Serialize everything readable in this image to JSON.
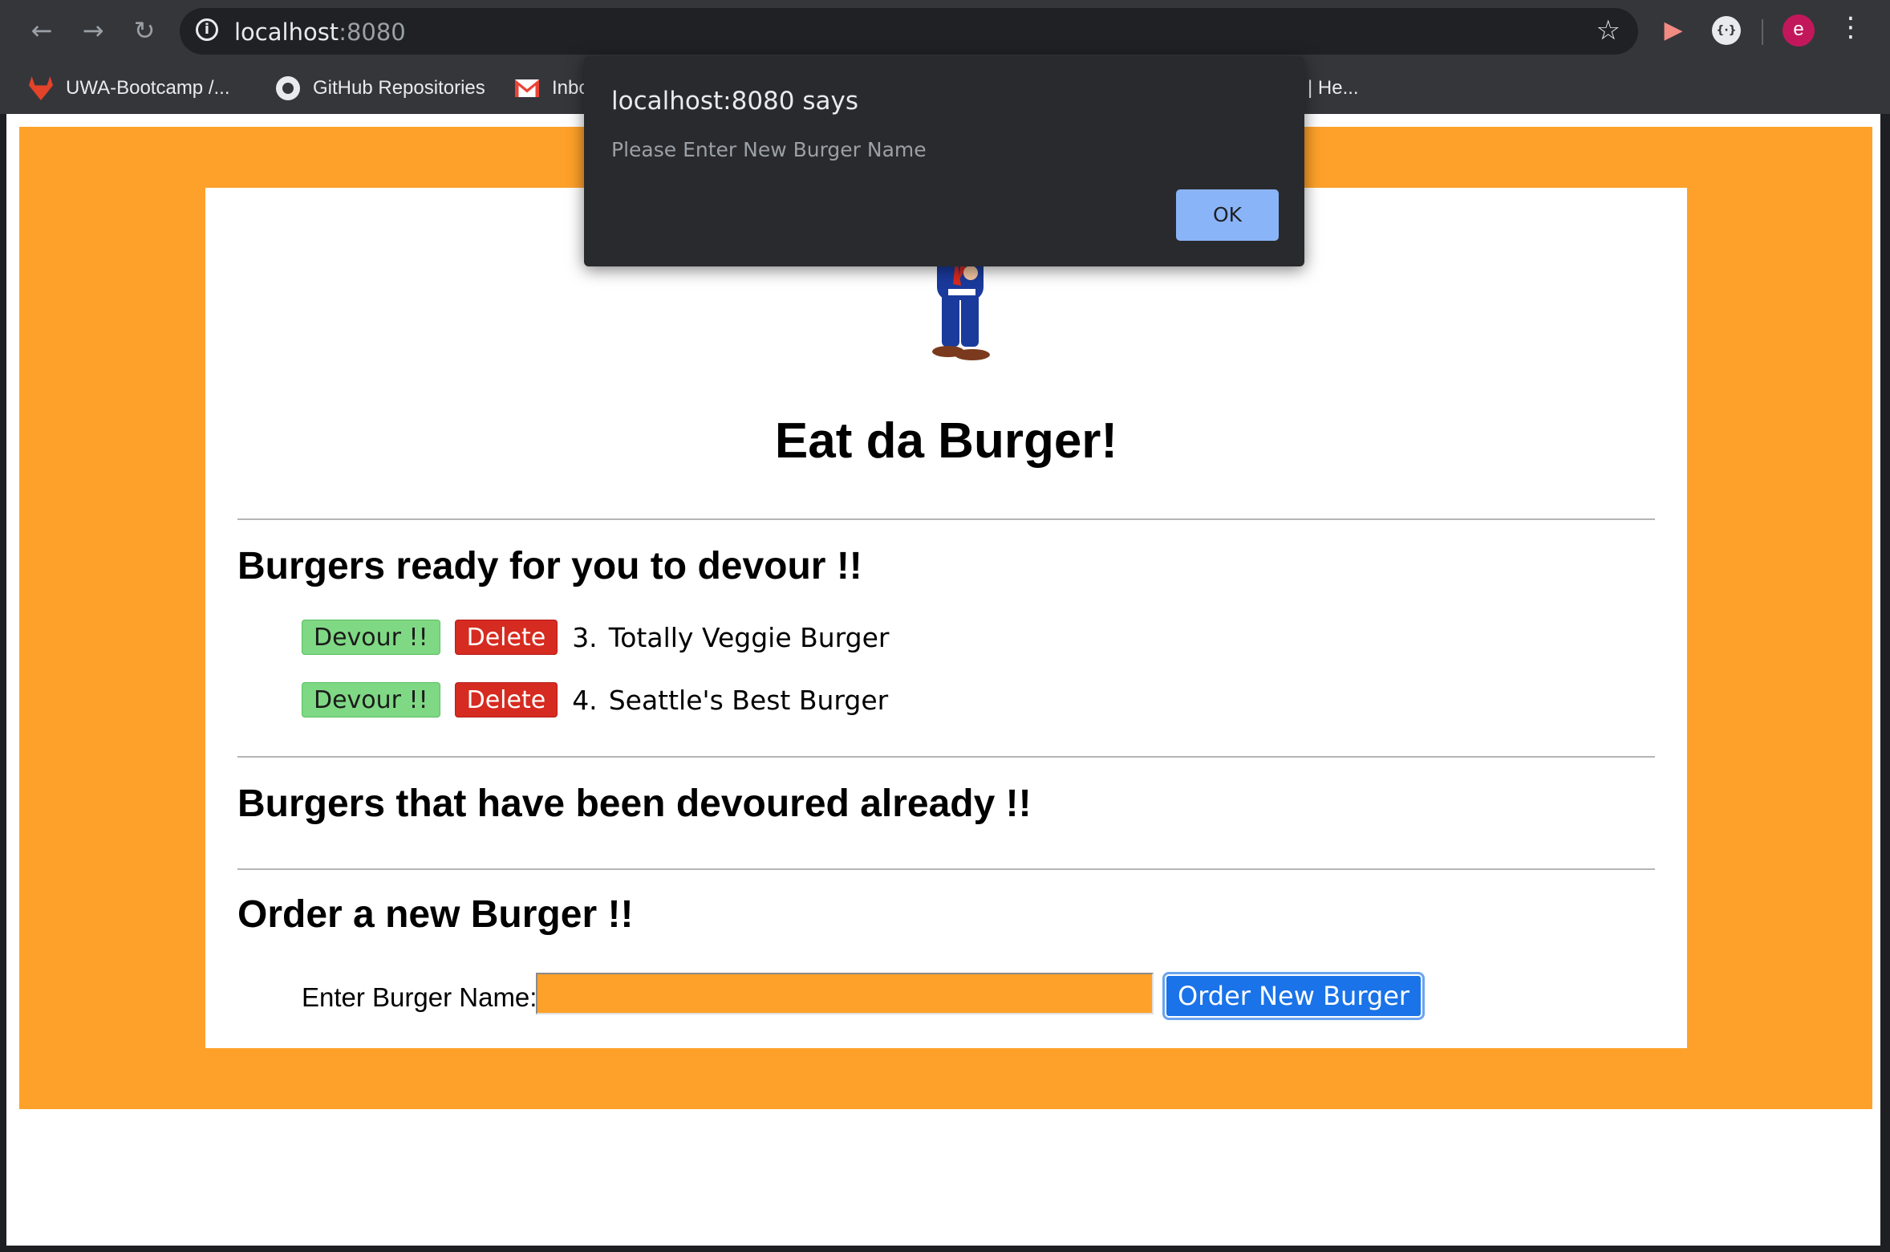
{
  "browser": {
    "nav": {
      "back_glyph": "←",
      "forward_glyph": "→",
      "reload_glyph": "↻"
    },
    "address": {
      "host": "localhost",
      "port": ":8080"
    },
    "icons": [
      "info-icon",
      "star-icon",
      "extension-icon",
      "extension-icon",
      "profile-avatar",
      "menu-icon"
    ],
    "avatar_letter": "e",
    "bookmarks": [
      {
        "label": "UWA-Bootcamp /...",
        "icon": "gitlab-icon"
      },
      {
        "label": "GitHub Repositories",
        "icon": "github-icon"
      },
      {
        "label": "Inbo",
        "icon": "gmail-icon"
      },
      {
        "label": "| He...",
        "icon": ""
      }
    ]
  },
  "page": {
    "title": "Eat da Burger!",
    "ready_heading": "Burgers ready for you to devour !!",
    "ready_burgers": [
      {
        "number": "3.",
        "name": "Totally Veggie Burger",
        "devour_label": "Devour !!",
        "delete_label": "Delete"
      },
      {
        "number": "4.",
        "name": "Seattle's Best Burger",
        "devour_label": "Devour !!",
        "delete_label": "Delete"
      }
    ],
    "devoured_heading": "Burgers that have been devoured already !!",
    "order_heading": "Order a new Burger !!",
    "order_form": {
      "label": "Enter Burger Name:",
      "input_value": "",
      "button_label": "Order New Burger"
    }
  },
  "dialog": {
    "title": "localhost:8080 says",
    "message": "Please Enter New Burger Name",
    "ok_label": "OK"
  },
  "colors": {
    "page_background": "#fea12a",
    "devour_button": "#7fd884",
    "delete_button": "#d62b20",
    "order_button": "#1a73e8",
    "dialog_background": "#292a2d",
    "dialog_ok": "#8ab4f8"
  }
}
